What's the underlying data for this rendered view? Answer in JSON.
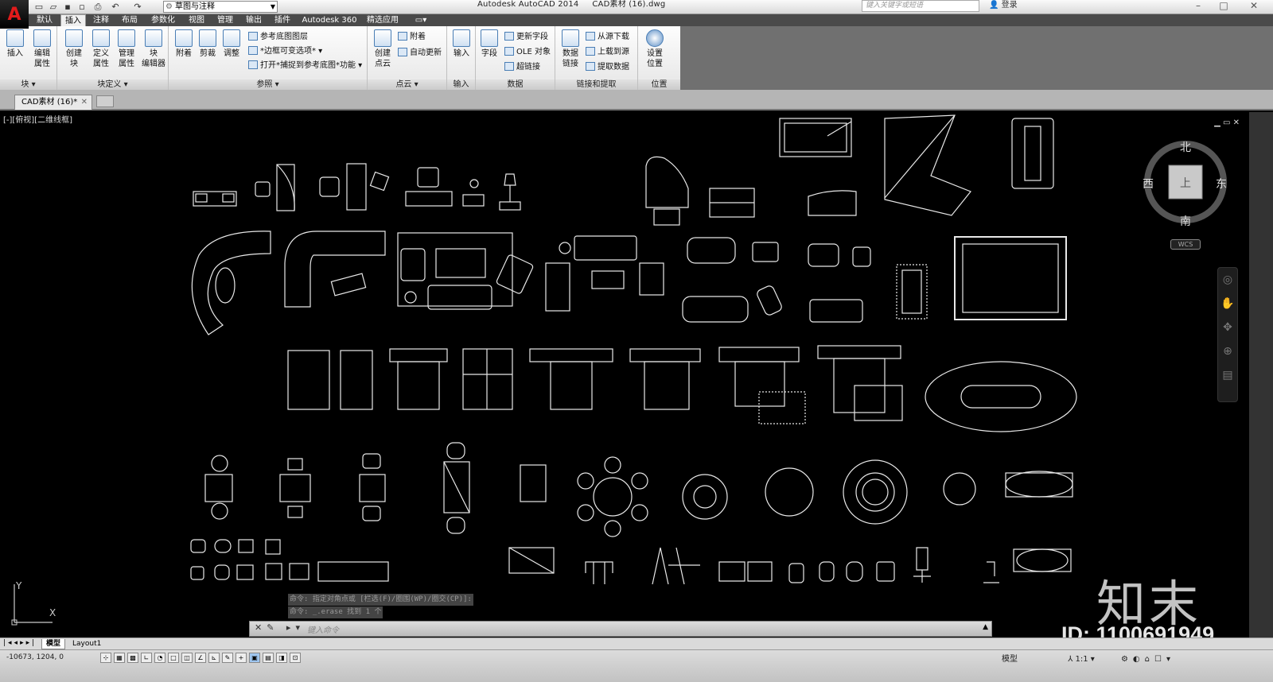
{
  "title_bar": {
    "app_title": "Autodesk AutoCAD 2014",
    "file_name": "CAD素材 (16).dwg",
    "workspace": "草图与注释",
    "search_placeholder": "键入关键字或短语",
    "login": "登录"
  },
  "ribbon_tabs": [
    "默认",
    "插入",
    "注释",
    "布局",
    "参数化",
    "视图",
    "管理",
    "输出",
    "插件",
    "Autodesk 360",
    "精选应用"
  ],
  "active_tab": "插入",
  "panels": {
    "block": {
      "title": "块",
      "insert": "插入",
      "edit_attr": "编辑\n属性"
    },
    "block_def": {
      "title": "块定义",
      "create": "创建\n块",
      "define_attr": "定义\n属性",
      "manage_attr": "管理\n属性",
      "block_editor": "块\n编辑器"
    },
    "reference": {
      "title": "参照",
      "attach": "附着",
      "clip": "剪裁",
      "adjust": "调整",
      "underlay_layers": "参考底图图层",
      "frame": "*边框可变选项*",
      "snap": "打开*捕捉到参考底图*功能"
    },
    "point_cloud": {
      "title": "点云",
      "create": "创建\n点云",
      "attach": "附着",
      "auto_update": "自动更新"
    },
    "import": {
      "title": "输入",
      "import": "输入"
    },
    "data": {
      "title": "数据",
      "field": "字段",
      "update_fields": "更新字段",
      "ole": "OLE 对象",
      "hyperlink": "超链接"
    },
    "linking": {
      "title": "链接和提取",
      "data_link": "数据\n链接",
      "download": "从源下载",
      "upload": "上载到源",
      "extract": "提取数据"
    },
    "location": {
      "title": "位置",
      "set_location": "设置\n位置"
    }
  },
  "doc_tab": "CAD素材 (16)*",
  "viewport_label": "[-][俯视][二维线框]",
  "viewcube": {
    "north": "北",
    "south": "南",
    "east": "东",
    "west": "西",
    "top": "上",
    "wcs": "WCS"
  },
  "command_history": [
    "命令: 指定对角点或 [栏选(F)/圈围(WP)/圈交(CP)]:",
    "命令: _.erase 找到 1 个"
  ],
  "command_placeholder": "键入命令",
  "layout_tabs": [
    "模型",
    "Layout1"
  ],
  "coordinates": "-10673, 1204, 0",
  "status_right": {
    "model": "模型",
    "scale": "1:1"
  },
  "watermark": {
    "brand": "知末",
    "id": "ID: 1100691949"
  }
}
